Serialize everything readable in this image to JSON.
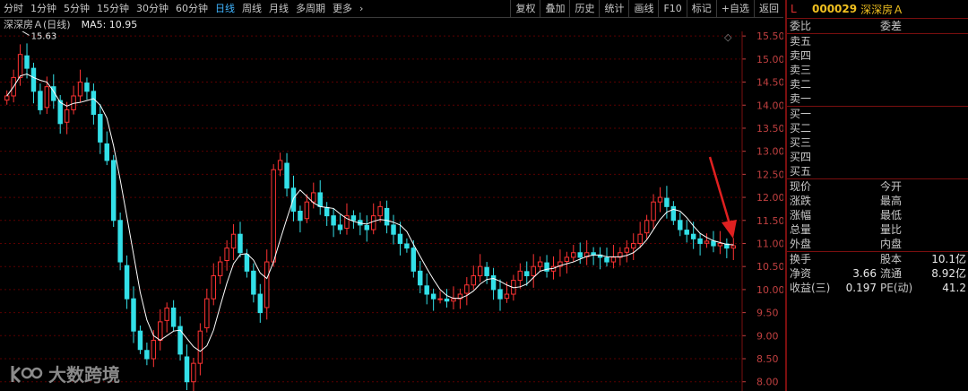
{
  "toolbar": {
    "tabs": [
      "分时",
      "1分钟",
      "5分钟",
      "15分钟",
      "30分钟",
      "60分钟",
      "日线",
      "周线",
      "月线",
      "多周期",
      "更多"
    ],
    "active_tab": "日线",
    "tools": [
      "复权",
      "叠加",
      "历史",
      "统计",
      "画线",
      "F10",
      "标记",
      "+自选",
      "返回"
    ]
  },
  "chart_header": {
    "name": "深深房Ａ(日线)",
    "indicator": "MA5: 10.95"
  },
  "colors": {
    "up": "#ff3333",
    "down": "#33e0e8",
    "grid": "#5a0000",
    "ma": "#ffffff",
    "axis_text": "#c04040"
  },
  "chart_data": {
    "type": "candlestick",
    "ylim": [
      7.8,
      15.6
    ],
    "yticks": [
      "15.50",
      "15.00",
      "14.50",
      "14.00",
      "13.50",
      "13.00",
      "12.50",
      "12.00",
      "11.50",
      "11.00",
      "10.50",
      "10.00",
      "9.50",
      "9.00",
      "8.50",
      "8.00"
    ],
    "max_label": "15.63",
    "close_series": [
      14.2,
      14.6,
      15.1,
      14.8,
      14.3,
      13.9,
      14.4,
      14.1,
      13.6,
      13.9,
      14.2,
      14.5,
      14.3,
      13.8,
      13.2,
      12.8,
      11.5,
      10.6,
      9.8,
      9.1,
      8.7,
      8.5,
      8.9,
      9.3,
      9.6,
      9.2,
      8.6,
      8.0,
      8.4,
      9.1,
      9.8,
      10.3,
      10.6,
      10.9,
      11.2,
      10.8,
      10.4,
      9.9,
      9.5,
      10.6,
      12.6,
      12.8,
      12.2,
      11.7,
      11.5,
      11.9,
      12.1,
      11.8,
      11.6,
      11.4,
      11.3,
      11.6,
      11.5,
      11.4,
      11.3,
      11.6,
      11.8,
      11.4,
      11.2,
      11.0,
      10.9,
      10.4,
      10.1,
      9.9,
      9.8,
      9.8,
      9.75,
      9.8,
      9.9,
      10.1,
      10.3,
      10.5,
      10.3,
      10.0,
      9.8,
      9.9,
      10.2,
      10.4,
      10.3,
      10.5,
      10.6,
      10.4,
      10.5,
      10.6,
      10.7,
      10.8,
      10.7,
      10.8,
      10.75,
      10.7,
      10.6,
      10.7,
      10.8,
      10.9,
      11.0,
      11.2,
      11.5,
      11.9,
      12.0,
      11.8,
      11.5,
      11.3,
      11.2,
      11.1,
      11.0,
      11.05,
      10.95,
      11.0,
      10.9,
      10.95
    ]
  },
  "quote": {
    "code": "000029",
    "name": "深深房Ａ",
    "market": "L",
    "header_left": "委比",
    "header_right": "委差",
    "sells": [
      "卖五",
      "卖四",
      "卖三",
      "卖二",
      "卖一"
    ],
    "buys": [
      "买一",
      "买二",
      "买三",
      "买四",
      "买五"
    ],
    "stats": [
      {
        "l1": "现价",
        "l2": "今开"
      },
      {
        "l1": "涨跌",
        "l2": "最高"
      },
      {
        "l1": "涨幅",
        "l2": "最低"
      },
      {
        "l1": "总量",
        "l2": "量比"
      },
      {
        "l1": "外盘",
        "l2": "内盘"
      }
    ],
    "fundamentals": [
      {
        "l1": "换手",
        "v1": "",
        "l2": "股本",
        "v2": "10.1亿"
      },
      {
        "l1": "净资",
        "v1": "3.66",
        "l2": "流通",
        "v2": "8.92亿"
      },
      {
        "l1": "收益(三)",
        "v1": "0.197",
        "l2": "PE(动)",
        "v2": "41.2"
      }
    ]
  },
  "watermark": {
    "text": "大数跨境"
  }
}
